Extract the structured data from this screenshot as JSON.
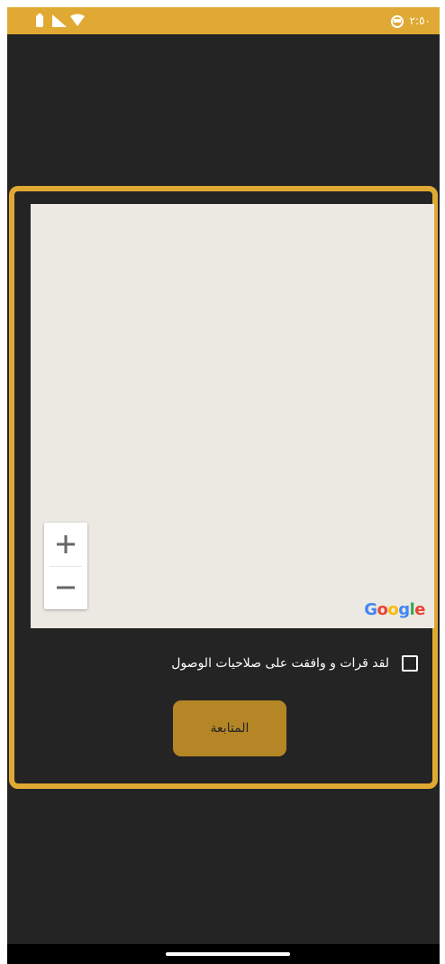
{
  "status_bar": {
    "time": "٢:٥٠",
    "icons": [
      "wifi-icon",
      "signal-icon",
      "battery-icon",
      "alarm-icon"
    ]
  },
  "map": {
    "attribution": "Google",
    "zoom_in_label": "+",
    "zoom_out_label": "−"
  },
  "consent": {
    "label": "لقد قرات و وافقت على صلاحيات الوصول",
    "checked": false
  },
  "continue_button": {
    "label": "المتابعة"
  },
  "colors": {
    "accent": "#e0a933",
    "button": "#b58626",
    "background": "#242424",
    "map": "#ece9e2"
  }
}
